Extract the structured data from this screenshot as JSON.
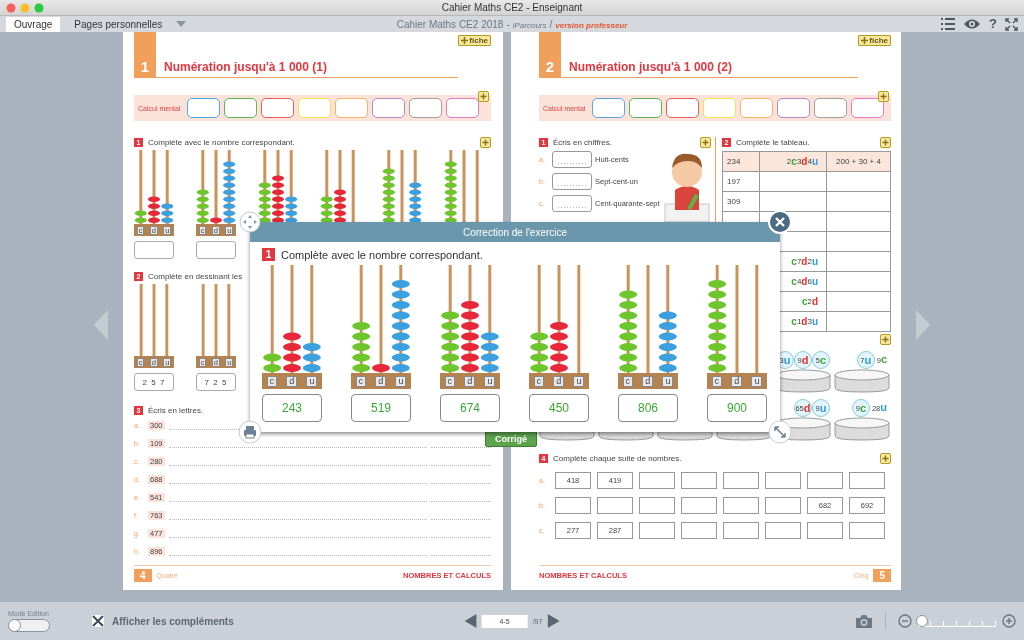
{
  "window": {
    "title": "Cahier Maths CE2 - Enseignant"
  },
  "toolbar": {
    "tabs": [
      {
        "label": "Ouvrage",
        "selected": true
      },
      {
        "label": "Pages personnelles",
        "selected": false
      }
    ],
    "book": {
      "title": "Cahier Maths CE2 2018",
      "separator": "-",
      "series": "iParcours",
      "slash": "/",
      "edition": "version professeur"
    },
    "help": "?"
  },
  "pages": [
    {
      "fiche": "fiche",
      "number": "1",
      "title": "Numération jusqu'à 1 000 (1)",
      "mental": {
        "label": "Calcul mental",
        "boxes": [
          {
            "color": "#5aa9e6"
          },
          {
            "color": "#5cb85c"
          },
          {
            "color": "#e8605a"
          },
          {
            "color": "#f2e34c"
          },
          {
            "color": "#f4b26b"
          },
          {
            "color": "#b08acb"
          },
          {
            "color": "#a0a0a0"
          },
          {
            "color": "#e07bbf"
          }
        ]
      },
      "exercises": [
        {
          "kind": "abacus",
          "number": "1",
          "instruction": "Complète avec le nombre correspondant.",
          "abaci": [
            {
              "labels": [
                "c",
                "d",
                "u"
              ]
            },
            {
              "labels": [
                "c",
                "d",
                "u"
              ]
            }
          ]
        },
        {
          "kind": "draw",
          "number": "2",
          "instruction": "Complète en dessinant les",
          "abaci": [
            {
              "labels": [
                "c",
                "d",
                "u"
              ],
              "answer": "2 5 7"
            },
            {
              "labels": [
                "c",
                "d",
                "u"
              ],
              "answer": "7 2 5"
            }
          ]
        },
        {
          "kind": "words",
          "number": "3",
          "instruction": "Écris en lettres.",
          "items": [
            {
              "letter": "a.",
              "value": "300"
            },
            {
              "letter": "b.",
              "value": "109"
            },
            {
              "letter": "c.",
              "value": "280"
            },
            {
              "letter": "d.",
              "value": "688"
            },
            {
              "letter": "e.",
              "value": "541"
            },
            {
              "letter": "f.",
              "value": "763"
            },
            {
              "letter": "g.",
              "value": "477"
            },
            {
              "letter": "h.",
              "value": "896"
            }
          ]
        }
      ],
      "footer": {
        "number": "4",
        "word": "Quatre",
        "section": "NOMBRES ET CALCULS"
      }
    },
    {
      "fiche": "fiche",
      "number": "2",
      "title": "Numération jusqu'à 1 000 (2)",
      "mental": {
        "label": "Calcul mental",
        "boxes": [
          {
            "color": "#5aa9e6"
          },
          {
            "color": "#5cb85c"
          },
          {
            "color": "#e8605a"
          },
          {
            "color": "#f2e34c"
          },
          {
            "color": "#f4b26b"
          },
          {
            "color": "#b08acb"
          },
          {
            "color": "#a0a0a0"
          },
          {
            "color": "#e07bbf"
          }
        ]
      },
      "exercises": [
        {
          "kind": "figures",
          "number": "1",
          "instruction": "Écris en chiffres.",
          "items": [
            {
              "letter": "a.",
              "text": "Huit-cents"
            },
            {
              "letter": "b.",
              "text": "Sept-cent-un"
            },
            {
              "letter": "c.",
              "text": "Cent-quarante-sept"
            }
          ]
        },
        {
          "kind": "table",
          "number": "2",
          "instruction": "Complète le tableau.",
          "rows": [
            {
              "example": true,
              "cells": [
                {
                  "text": "234"
                },
                {
                  "parts": [
                    {
                      "text": "2"
                    },
                    {
                      "text": "c",
                      "color": "#3aaa35"
                    },
                    {
                      "text": " 3"
                    },
                    {
                      "text": "d",
                      "color": "#e5332a"
                    },
                    {
                      "text": " 4"
                    },
                    {
                      "text": "u",
                      "color": "#2a9fd8"
                    }
                  ]
                },
                {
                  "text": "200 + 30 + 4"
                }
              ]
            },
            {
              "example": false,
              "cells": [
                {
                  "text": "197"
                },
                {},
                {}
              ]
            },
            {
              "example": false,
              "cells": [
                {
                  "text": "309"
                },
                {},
                {}
              ]
            },
            {
              "example": false,
              "cells": [
                {},
                {},
                {}
              ]
            },
            {
              "example": false,
              "cells": [
                {},
                {},
                {}
              ]
            },
            {
              "example": false,
              "cells": [
                {},
                {
                  "parts": [
                    {
                      "text": "c",
                      "color": "#3aaa35"
                    },
                    {
                      "text": " 7"
                    },
                    {
                      "text": "d",
                      "color": "#e5332a"
                    },
                    {
                      "text": " 2"
                    },
                    {
                      "text": "u",
                      "color": "#2a9fd8"
                    }
                  ]
                },
                {}
              ]
            },
            {
              "example": false,
              "cells": [
                {},
                {
                  "parts": [
                    {
                      "text": "c",
                      "color": "#3aaa35"
                    },
                    {
                      "text": " 4"
                    },
                    {
                      "text": "d",
                      "color": "#e5332a"
                    },
                    {
                      "text": " 6"
                    },
                    {
                      "text": "u",
                      "color": "#2a9fd8"
                    }
                  ]
                },
                {}
              ]
            },
            {
              "example": false,
              "cells": [
                {},
                {
                  "parts": [
                    {
                      "text": "c",
                      "color": "#3aaa35"
                    },
                    {
                      "text": " 2"
                    },
                    {
                      "text": "d",
                      "color": "#e5332a"
                    }
                  ]
                },
                {}
              ]
            },
            {
              "example": false,
              "cells": [
                {},
                {
                  "parts": [
                    {
                      "text": "c",
                      "color": "#3aaa35"
                    },
                    {
                      "text": " 1"
                    },
                    {
                      "text": "d",
                      "color": "#e5332a"
                    },
                    {
                      "text": " 3"
                    },
                    {
                      "text": "u",
                      "color": "#2a9fd8"
                    }
                  ]
                },
                {}
              ]
            }
          ]
        },
        {
          "kind": "trays",
          "rows": [
            [
              {},
              {},
              {},
              {},
              {
                "tokens": [
                  {
                    "kind": "bubble",
                    "parts": [
                      {
                        "text": "3"
                      },
                      {
                        "text": "u",
                        "color": "#2a9fd8"
                      }
                    ]
                  },
                  {
                    "kind": "bubble",
                    "parts": [
                      {
                        "text": "9"
                      },
                      {
                        "text": "d",
                        "color": "#e5332a"
                      }
                    ]
                  },
                  {
                    "kind": "bubble",
                    "parts": [
                      {
                        "text": "5"
                      },
                      {
                        "text": "c",
                        "color": "#3aaa35"
                      }
                    ]
                  }
                ]
              },
              {
                "tokens": [
                  {
                    "kind": "bubble",
                    "parts": [
                      {
                        "text": "7"
                      },
                      {
                        "text": "u",
                        "color": "#2a9fd8"
                      }
                    ]
                  },
                  {
                    "kind": "plain",
                    "parts": [
                      {
                        "text": "9"
                      },
                      {
                        "text": "c",
                        "color": "#3aaa35"
                      }
                    ]
                  }
                ]
              }
            ],
            [
              {},
              {},
              {},
              {},
              {
                "tokens": [
                  {
                    "kind": "bubble",
                    "parts": [
                      {
                        "text": "65"
                      },
                      {
                        "text": "d",
                        "color": "#e5332a"
                      }
                    ]
                  },
                  {
                    "kind": "bubble",
                    "parts": [
                      {
                        "text": "9"
                      },
                      {
                        "text": "u",
                        "color": "#2a9fd8"
                      }
                    ]
                  }
                ]
              },
              {
                "tokens": [
                  {
                    "kind": "bubble",
                    "parts": [
                      {
                        "text": "9"
                      },
                      {
                        "text": "c",
                        "color": "#3aaa35"
                      }
                    ]
                  },
                  {
                    "kind": "plain",
                    "parts": [
                      {
                        "text": "28"
                      },
                      {
                        "text": "u",
                        "color": "#2a9fd8"
                      }
                    ]
                  }
                ]
              }
            ]
          ]
        },
        {
          "kind": "sequence",
          "number": "4",
          "instruction": "Complète chaque suite de nombres.",
          "rows": [
            {
              "letter": "a.",
              "cells": [
                {
                  "value": "418"
                },
                {
                  "value": "419"
                },
                {},
                {},
                {},
                {},
                {},
                {}
              ]
            },
            {
              "letter": "b.",
              "cells": [
                {},
                {},
                {},
                {},
                {},
                {},
                {
                  "value": "682"
                },
                {
                  "value": "692"
                }
              ]
            },
            {
              "letter": "c.",
              "cells": [
                {
                  "value": "277"
                },
                {
                  "value": "287"
                },
                {},
                {},
                {},
                {},
                {},
                {}
              ]
            }
          ]
        }
      ],
      "footer": {
        "number": "5",
        "word": "Cinq",
        "section": "NOMBRES ET CALCULS"
      }
    }
  ],
  "correction": {
    "title": "Correction de l'exercice",
    "number": "1",
    "instruction": "Complète avec le nombre correspondant.",
    "abaci": [
      {
        "labels": [
          "c",
          "d",
          "u"
        ],
        "answer": "243"
      },
      {
        "labels": [
          "c",
          "d",
          "u"
        ],
        "answer": "519"
      },
      {
        "labels": [
          "c",
          "d",
          "u"
        ],
        "answer": "674"
      },
      {
        "labels": [
          "c",
          "d",
          "u"
        ],
        "answer": "450"
      },
      {
        "labels": [
          "c",
          "d",
          "u"
        ],
        "answer": "806"
      },
      {
        "labels": [
          "c",
          "d",
          "u"
        ],
        "answer": "900"
      }
    ],
    "button": "Corrigé"
  },
  "bottom_bar": {
    "mode_label": "Mode Edition",
    "mode_on": false,
    "supplements": {
      "label": "Afficher les compléments",
      "checked": true
    },
    "page_field": "4-5",
    "page_total": "/97",
    "zoom": {
      "level": 0.05
    }
  }
}
